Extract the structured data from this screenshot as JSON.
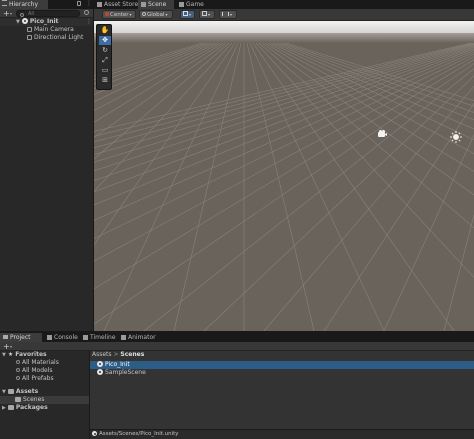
{
  "hierarchy": {
    "tab_label": "Hierarchy",
    "add_label": "+",
    "search_placeholder": "All",
    "scene_name": "Pico_Init",
    "items": [
      "Main Camera",
      "Directional Light"
    ]
  },
  "top_tabs": [
    "Asset Store",
    "Scene",
    "Game"
  ],
  "scene_toolbar": {
    "pivot_label": "Center",
    "space_label": "Global"
  },
  "bottom_tabs": [
    "Project",
    "Console",
    "Timeline",
    "Animator"
  ],
  "project": {
    "add_label": "+",
    "favorites_label": "Favorites",
    "favorites": [
      "All Materials",
      "All Models",
      "All Prefabs"
    ],
    "assets_label": "Assets",
    "assets_children": [
      "Scenes"
    ],
    "packages_label": "Packages",
    "breadcrumb_root": "Assets",
    "breadcrumb_sep": ">",
    "breadcrumb_current": "Scenes",
    "files": [
      "Pico_Init",
      "SampleScene"
    ],
    "selected_file_index": 0,
    "status_path": "Assets/Scenes/Pico_Init.unity"
  },
  "colors": {
    "selection": "#2c5d87",
    "sky": "#ececec",
    "ground": "#6a635c",
    "grid": "#8f8881"
  }
}
